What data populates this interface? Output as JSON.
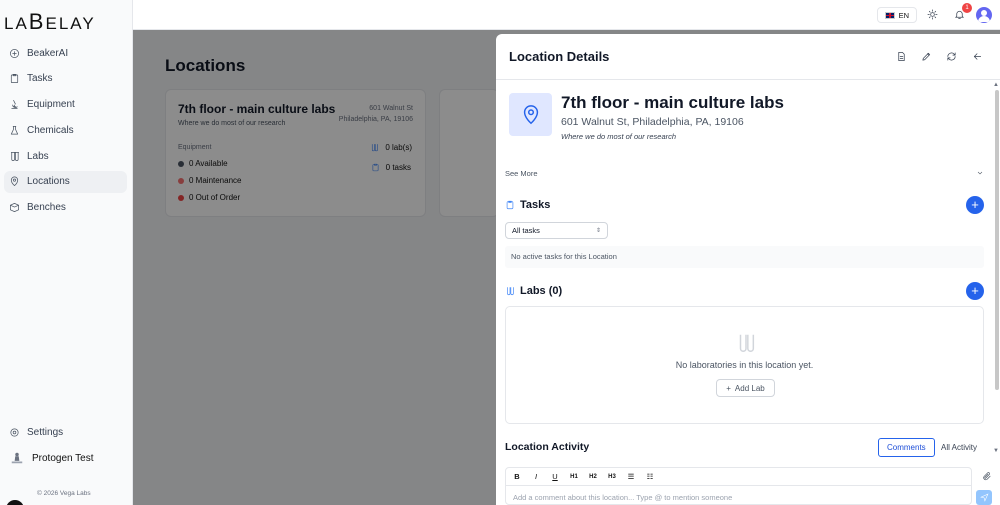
{
  "app": {
    "logo_left": "LA",
    "logo_big": "B",
    "logo_right": "ELAY"
  },
  "sidebar": {
    "items": [
      {
        "label": "BeakerAI",
        "icon": "beaker-ai-icon"
      },
      {
        "label": "Tasks",
        "icon": "clipboard-icon"
      },
      {
        "label": "Equipment",
        "icon": "microscope-icon"
      },
      {
        "label": "Chemicals",
        "icon": "flask-icon"
      },
      {
        "label": "Labs",
        "icon": "test-tubes-icon"
      },
      {
        "label": "Locations",
        "icon": "map-pin-icon",
        "active": true
      },
      {
        "label": "Benches",
        "icon": "box-icon"
      }
    ],
    "settings_label": "Settings",
    "user_name": "Protogen Test",
    "copyright": "© 2026 Vega Labs"
  },
  "header": {
    "lang": "EN",
    "notifications": "1"
  },
  "page": {
    "title": "Locations",
    "card": {
      "title": "7th floor - main culture labs",
      "description": "Where we do most of our research",
      "address_line1": "601 Walnut St",
      "address_line2": "Philadelphia, PA, 19106",
      "equipment_label": "Equipment",
      "available": "0 Available",
      "maintenance": "0 Maintenance",
      "out_of_order": "0 Out of Order",
      "labs_count": "0 lab(s)",
      "tasks_count": "0 tasks"
    }
  },
  "panel": {
    "title": "Location Details",
    "name": "7th floor - main culture labs",
    "address": "601 Walnut St, Philadelphia, PA, 19106",
    "description": "Where we do most of our research",
    "see_more": "See More",
    "tasks_title": "Tasks",
    "tasks_filter": "All tasks",
    "tasks_empty": "No active tasks for this Location",
    "labs_title": "Labs (0)",
    "labs_empty": "No laboratories in this location yet.",
    "add_lab": "Add Lab",
    "activity_title": "Location Activity",
    "tab_comments": "Comments",
    "tab_all": "All Activity",
    "comment_placeholder": "Add a comment about this location... Type @ to mention someone",
    "toolbar": [
      "B",
      "I",
      "U",
      "H1",
      "H2",
      "H3"
    ]
  },
  "colors": {
    "accent": "#2563eb",
    "available": "#4b5563",
    "maintenance": "#f87171",
    "out_of_order": "#ef4444"
  }
}
